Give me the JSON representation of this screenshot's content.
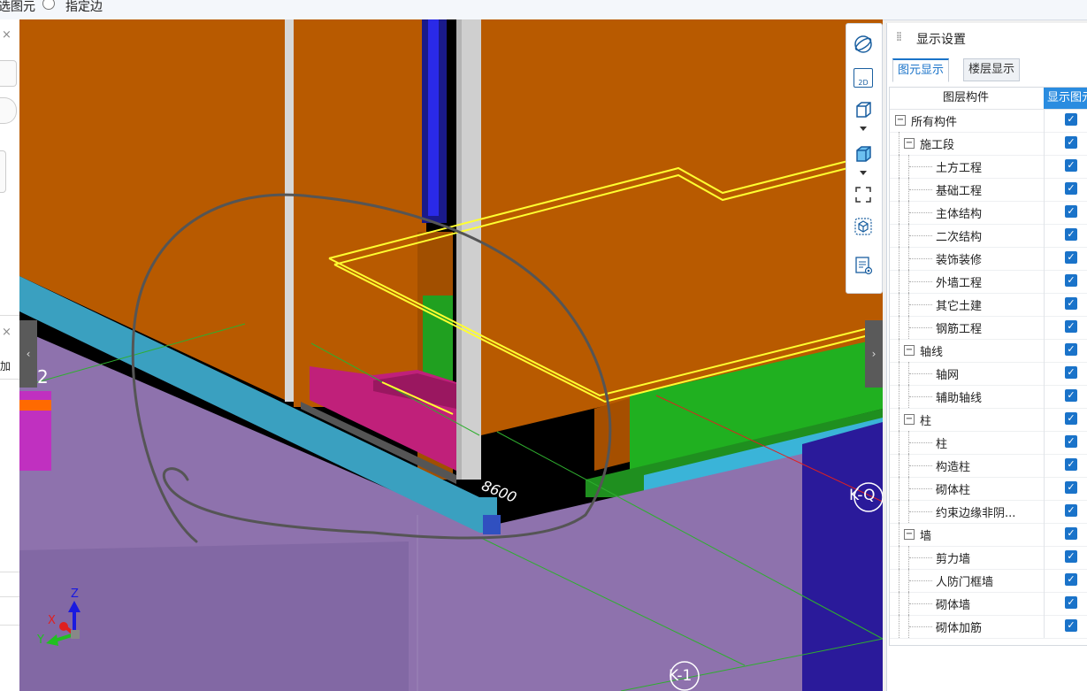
{
  "toolbar": {
    "left_text": "选图元",
    "right_text": "指定边"
  },
  "left_panel": {
    "close1": "×",
    "close2": "×",
    "add_text": "加"
  },
  "viewport": {
    "dimension_label": "8600",
    "axis_left": "2",
    "axis_k_q": "K-Q",
    "axis_k_1": "K-1",
    "axes_triad": {
      "z": "Z",
      "x": "X",
      "y": "Y"
    },
    "nav_left": "‹",
    "nav_right": "›"
  },
  "view_tools": {
    "icons": [
      "orbit-icon",
      "2d-view-icon",
      "3d-box-icon",
      "3d-box-filled-icon",
      "zoom-extents-icon",
      "view-cube-icon",
      "properties-view-icon"
    ],
    "label_2d": "2D"
  },
  "display_panel": {
    "title": "显示设置",
    "tabs": [
      {
        "label": "图元显示",
        "active": true
      },
      {
        "label": "楼层显示",
        "active": false
      }
    ],
    "columns": {
      "component": "图层构件",
      "visible": "显示图元"
    },
    "rows": [
      {
        "label": "所有构件",
        "level": 0,
        "expandable": true,
        "checked": true
      },
      {
        "label": "施工段",
        "level": 1,
        "expandable": true,
        "checked": true
      },
      {
        "label": "土方工程",
        "level": 2,
        "expandable": false,
        "checked": true
      },
      {
        "label": "基础工程",
        "level": 2,
        "expandable": false,
        "checked": true
      },
      {
        "label": "主体结构",
        "level": 2,
        "expandable": false,
        "checked": true
      },
      {
        "label": "二次结构",
        "level": 2,
        "expandable": false,
        "checked": true
      },
      {
        "label": "装饰装修",
        "level": 2,
        "expandable": false,
        "checked": true
      },
      {
        "label": "外墙工程",
        "level": 2,
        "expandable": false,
        "checked": true
      },
      {
        "label": "其它土建",
        "level": 2,
        "expandable": false,
        "checked": true
      },
      {
        "label": "钢筋工程",
        "level": 2,
        "expandable": false,
        "checked": true
      },
      {
        "label": "轴线",
        "level": 1,
        "expandable": true,
        "checked": true
      },
      {
        "label": "轴网",
        "level": 2,
        "expandable": false,
        "checked": true
      },
      {
        "label": "辅助轴线",
        "level": 2,
        "expandable": false,
        "checked": true
      },
      {
        "label": "柱",
        "level": 1,
        "expandable": true,
        "checked": true
      },
      {
        "label": "柱",
        "level": 2,
        "expandable": false,
        "checked": true
      },
      {
        "label": "构造柱",
        "level": 2,
        "expandable": false,
        "checked": true
      },
      {
        "label": "砌体柱",
        "level": 2,
        "expandable": false,
        "checked": true
      },
      {
        "label": "约束边缘非阴...",
        "level": 2,
        "expandable": false,
        "checked": true
      },
      {
        "label": "墙",
        "level": 1,
        "expandable": true,
        "checked": true
      },
      {
        "label": "剪力墙",
        "level": 2,
        "expandable": false,
        "checked": true
      },
      {
        "label": "人防门框墙",
        "level": 2,
        "expandable": false,
        "checked": true
      },
      {
        "label": "砌体墙",
        "level": 2,
        "expandable": false,
        "checked": true
      },
      {
        "label": "砌体加筋",
        "level": 2,
        "expandable": false,
        "checked": true
      }
    ],
    "expand_symbol": "−",
    "check_symbol": "✓"
  },
  "colors": {
    "accent": "#1a73c9",
    "wall_orange": "#b85a00",
    "slab_purple": "#8e72ad",
    "beam_cyan": "#3aa0c0",
    "green": "#20b020",
    "yellow_outline": "#ffff30",
    "magenta": "#c0207a"
  }
}
